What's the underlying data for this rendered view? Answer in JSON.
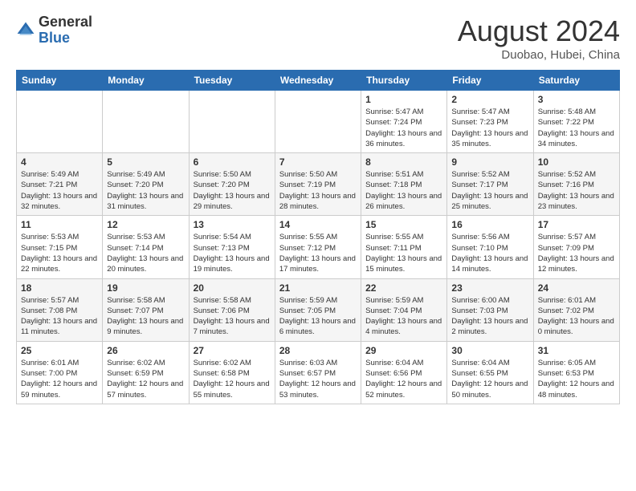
{
  "header": {
    "logo": {
      "general": "General",
      "blue": "Blue"
    },
    "title": "August 2024",
    "location": "Duobao, Hubei, China"
  },
  "weekdays": [
    "Sunday",
    "Monday",
    "Tuesday",
    "Wednesday",
    "Thursday",
    "Friday",
    "Saturday"
  ],
  "weeks": [
    {
      "row_class": "row-odd",
      "days": [
        {
          "num": "",
          "info": ""
        },
        {
          "num": "",
          "info": ""
        },
        {
          "num": "",
          "info": ""
        },
        {
          "num": "",
          "info": ""
        },
        {
          "num": "1",
          "info": "Sunrise: 5:47 AM\nSunset: 7:24 PM\nDaylight: 13 hours\nand 36 minutes."
        },
        {
          "num": "2",
          "info": "Sunrise: 5:47 AM\nSunset: 7:23 PM\nDaylight: 13 hours\nand 35 minutes."
        },
        {
          "num": "3",
          "info": "Sunrise: 5:48 AM\nSunset: 7:22 PM\nDaylight: 13 hours\nand 34 minutes."
        }
      ]
    },
    {
      "row_class": "row-even",
      "days": [
        {
          "num": "4",
          "info": "Sunrise: 5:49 AM\nSunset: 7:21 PM\nDaylight: 13 hours\nand 32 minutes."
        },
        {
          "num": "5",
          "info": "Sunrise: 5:49 AM\nSunset: 7:20 PM\nDaylight: 13 hours\nand 31 minutes."
        },
        {
          "num": "6",
          "info": "Sunrise: 5:50 AM\nSunset: 7:20 PM\nDaylight: 13 hours\nand 29 minutes."
        },
        {
          "num": "7",
          "info": "Sunrise: 5:50 AM\nSunset: 7:19 PM\nDaylight: 13 hours\nand 28 minutes."
        },
        {
          "num": "8",
          "info": "Sunrise: 5:51 AM\nSunset: 7:18 PM\nDaylight: 13 hours\nand 26 minutes."
        },
        {
          "num": "9",
          "info": "Sunrise: 5:52 AM\nSunset: 7:17 PM\nDaylight: 13 hours\nand 25 minutes."
        },
        {
          "num": "10",
          "info": "Sunrise: 5:52 AM\nSunset: 7:16 PM\nDaylight: 13 hours\nand 23 minutes."
        }
      ]
    },
    {
      "row_class": "row-odd",
      "days": [
        {
          "num": "11",
          "info": "Sunrise: 5:53 AM\nSunset: 7:15 PM\nDaylight: 13 hours\nand 22 minutes."
        },
        {
          "num": "12",
          "info": "Sunrise: 5:53 AM\nSunset: 7:14 PM\nDaylight: 13 hours\nand 20 minutes."
        },
        {
          "num": "13",
          "info": "Sunrise: 5:54 AM\nSunset: 7:13 PM\nDaylight: 13 hours\nand 19 minutes."
        },
        {
          "num": "14",
          "info": "Sunrise: 5:55 AM\nSunset: 7:12 PM\nDaylight: 13 hours\nand 17 minutes."
        },
        {
          "num": "15",
          "info": "Sunrise: 5:55 AM\nSunset: 7:11 PM\nDaylight: 13 hours\nand 15 minutes."
        },
        {
          "num": "16",
          "info": "Sunrise: 5:56 AM\nSunset: 7:10 PM\nDaylight: 13 hours\nand 14 minutes."
        },
        {
          "num": "17",
          "info": "Sunrise: 5:57 AM\nSunset: 7:09 PM\nDaylight: 13 hours\nand 12 minutes."
        }
      ]
    },
    {
      "row_class": "row-even",
      "days": [
        {
          "num": "18",
          "info": "Sunrise: 5:57 AM\nSunset: 7:08 PM\nDaylight: 13 hours\nand 11 minutes."
        },
        {
          "num": "19",
          "info": "Sunrise: 5:58 AM\nSunset: 7:07 PM\nDaylight: 13 hours\nand 9 minutes."
        },
        {
          "num": "20",
          "info": "Sunrise: 5:58 AM\nSunset: 7:06 PM\nDaylight: 13 hours\nand 7 minutes."
        },
        {
          "num": "21",
          "info": "Sunrise: 5:59 AM\nSunset: 7:05 PM\nDaylight: 13 hours\nand 6 minutes."
        },
        {
          "num": "22",
          "info": "Sunrise: 5:59 AM\nSunset: 7:04 PM\nDaylight: 13 hours\nand 4 minutes."
        },
        {
          "num": "23",
          "info": "Sunrise: 6:00 AM\nSunset: 7:03 PM\nDaylight: 13 hours\nand 2 minutes."
        },
        {
          "num": "24",
          "info": "Sunrise: 6:01 AM\nSunset: 7:02 PM\nDaylight: 13 hours\nand 0 minutes."
        }
      ]
    },
    {
      "row_class": "row-odd",
      "days": [
        {
          "num": "25",
          "info": "Sunrise: 6:01 AM\nSunset: 7:00 PM\nDaylight: 12 hours\nand 59 minutes."
        },
        {
          "num": "26",
          "info": "Sunrise: 6:02 AM\nSunset: 6:59 PM\nDaylight: 12 hours\nand 57 minutes."
        },
        {
          "num": "27",
          "info": "Sunrise: 6:02 AM\nSunset: 6:58 PM\nDaylight: 12 hours\nand 55 minutes."
        },
        {
          "num": "28",
          "info": "Sunrise: 6:03 AM\nSunset: 6:57 PM\nDaylight: 12 hours\nand 53 minutes."
        },
        {
          "num": "29",
          "info": "Sunrise: 6:04 AM\nSunset: 6:56 PM\nDaylight: 12 hours\nand 52 minutes."
        },
        {
          "num": "30",
          "info": "Sunrise: 6:04 AM\nSunset: 6:55 PM\nDaylight: 12 hours\nand 50 minutes."
        },
        {
          "num": "31",
          "info": "Sunrise: 6:05 AM\nSunset: 6:53 PM\nDaylight: 12 hours\nand 48 minutes."
        }
      ]
    }
  ]
}
